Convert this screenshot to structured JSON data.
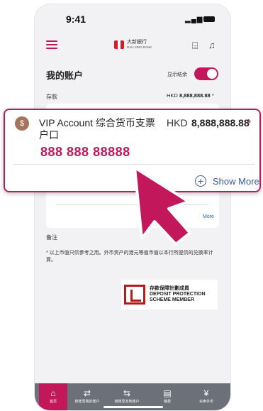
{
  "status_bar": {
    "time": "9:41"
  },
  "header": {
    "bank_name_cn": "大新銀行",
    "bank_name_en": "DAH SING BANK"
  },
  "accounts": {
    "title": "我的账户",
    "show_balance_label": "显示结余",
    "deposit_label": "存款",
    "deposit_currency": "HKD",
    "deposit_amount": "8,888,888.88",
    "deposit_mark": "*"
  },
  "highlighted_account": {
    "icon_letter": "$",
    "name": "VIP Account 综合货币支票户口",
    "currency": "HKD",
    "amount": "8,888,888.88",
    "account_number": "888 888 88888",
    "show_more": "Show More"
  },
  "inner_card": {
    "more_fragment": "More"
  },
  "remarks": {
    "title": "备注",
    "text": "* 以上市值只供参考之用。外币资产的港元等值市值以本行所提供的兑换率计算。"
  },
  "dps": {
    "cn": "存款保障計劃成員",
    "en1": "DEPOSIT PROTECTION",
    "en2": "SCHEME MEMBER"
  },
  "bottom_nav": [
    {
      "label": "首页",
      "icon": "home-icon",
      "glyph": "⌂"
    },
    {
      "label": "转账至我的账户",
      "icon": "transfer-own-icon",
      "glyph": "⇄"
    },
    {
      "label": "转账至本地账户",
      "icon": "transfer-local-icon",
      "glyph": "⇆"
    },
    {
      "label": "缴费",
      "icon": "bill-icon",
      "glyph": "▤"
    },
    {
      "label": "买卖外币",
      "icon": "fx-icon",
      "glyph": "¥"
    }
  ],
  "colors": {
    "accent": "#c2185b",
    "bottom_bar": "#6b7079",
    "link": "#3a5a9c"
  }
}
